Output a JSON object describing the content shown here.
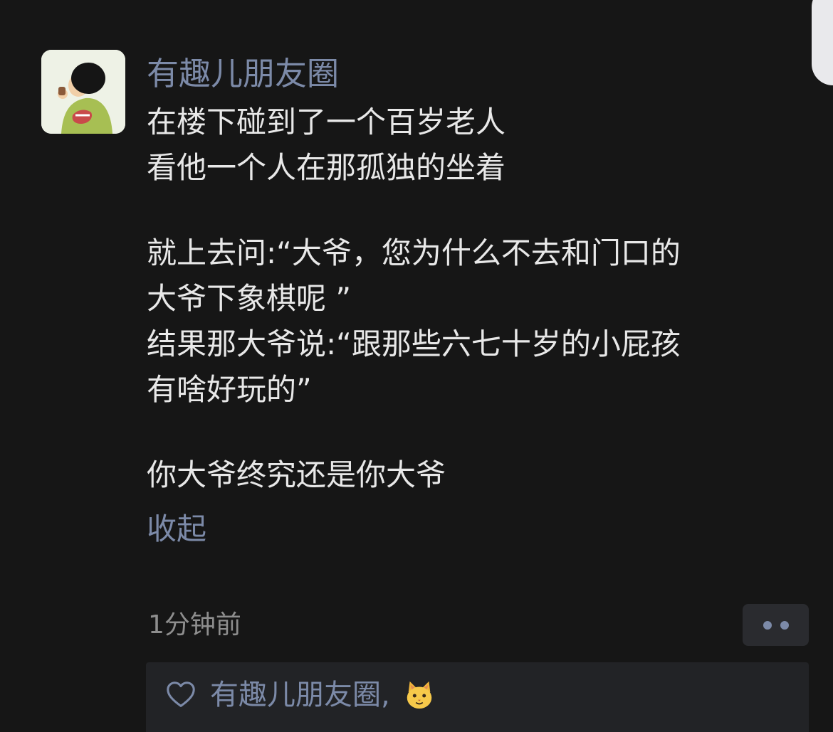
{
  "post": {
    "nickname": "有趣儿朋友圈",
    "content_lines": [
      "在楼下碰到了一个百岁老人",
      "看他一个人在那孤独的坐着",
      "",
      "就上去问:“大爷，您为什么不去和门口的",
      "大爷下象棋呢 ”",
      "结果那大爷说:“跟那些六七十岁的小屁孩",
      "有啥好玩的”",
      "",
      "你大爷终究还是你大爷"
    ],
    "collapse_label": "收起",
    "timestamp": "1分钟前"
  },
  "likes": {
    "names": "有趣儿朋友圈,",
    "reaction_icon": "cat-face-emoji"
  },
  "icons": {
    "avatar": "cartoon-boy-avatar",
    "more": "more-dots-icon",
    "like": "heart-outline-icon"
  },
  "colors": {
    "background": "#161616",
    "link": "#7c8aa8",
    "text": "#e8e8e8",
    "muted": "#8e8e8e",
    "panel": "#222326"
  }
}
